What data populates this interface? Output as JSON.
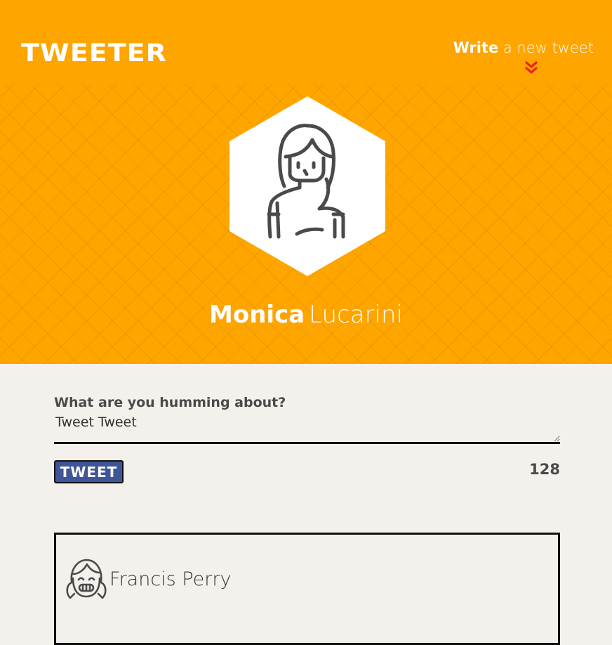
{
  "app": {
    "logo": "TWEETER"
  },
  "nav": {
    "compose_bold": "Write",
    "compose_rest": "a new tweet",
    "compose_icon": "double-chevron-down-icon",
    "chevron_color": "#e8251b"
  },
  "profile": {
    "first_name": "Monica",
    "last_name": "Lucarini",
    "avatar_icon": "woman-avatar-icon"
  },
  "composer": {
    "label": "What are you humming about?",
    "text_value": "Tweet Tweet",
    "button_label": "TWEET",
    "char_counter": "128"
  },
  "tweets": [
    {
      "author": "Francis Perry",
      "avatar_icon": "girl-smiling-avatar-icon"
    }
  ],
  "colors": {
    "header_bg": "#ffa500",
    "page_bg": "#f4f1ec",
    "button_bg": "#3f5597",
    "text_dark": "#4a4a4a"
  }
}
